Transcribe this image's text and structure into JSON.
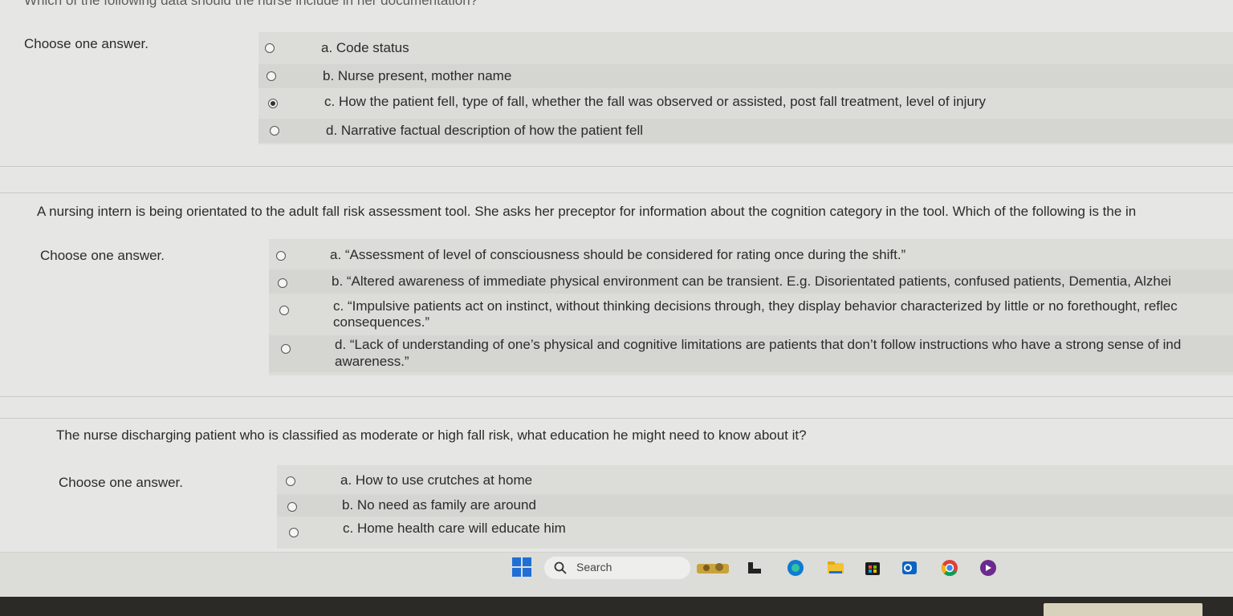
{
  "cut_off_header": "Which of the following data should the nurse include in her documentation?",
  "questions": [
    {
      "text": "",
      "choose_label": "Choose one answer.",
      "options": [
        {
          "label": "a. Code status",
          "checked": false
        },
        {
          "label": "b. Nurse present, mother name",
          "checked": false
        },
        {
          "label": "c. How the patient fell, type of fall, whether the fall was observed or assisted, post fall treatment, level of injury",
          "checked": true
        },
        {
          "label": "d. Narrative factual description of how the patient fell",
          "checked": false
        }
      ]
    },
    {
      "text": "A nursing intern is being orientated to the adult fall risk assessment tool. She asks her preceptor for information about the cognition category in the tool. Which of the following is the in",
      "choose_label": "Choose one answer.",
      "options": [
        {
          "label": "a. “Assessment of level of consciousness should be considered for rating once during the shift.”",
          "label2": "",
          "checked": false
        },
        {
          "label": "b. “Altered awareness of immediate physical environment can be transient. E.g. Disorientated patients, confused patients, Dementia, Alzhei",
          "label2": "",
          "checked": false
        },
        {
          "label": "c. “Impulsive patients act on instinct, without thinking decisions through, they display behavior characterized by little or no forethought, reflec",
          "label2": "consequences.”",
          "checked": false
        },
        {
          "label": "d. “Lack of understanding of one’s physical and cognitive limitations are patients that don’t follow instructions who have a strong sense of ind",
          "label2": "awareness.”",
          "checked": false
        }
      ]
    },
    {
      "text": "The nurse discharging patient who is classified as moderate or high fall risk, what education he might need to know about it?",
      "choose_label": "Choose one answer.",
      "options": [
        {
          "label": "a. How to use crutches at home",
          "checked": false
        },
        {
          "label": "b. No need as family are around",
          "checked": false
        },
        {
          "label": "c. Home health care will educate him",
          "checked": false
        }
      ]
    }
  ],
  "taskbar": {
    "search_placeholder": "Search",
    "icons": [
      "start-icon",
      "search-icon",
      "widgets-icon",
      "task-view-icon",
      "edge-icon",
      "file-explorer-icon",
      "store-icon",
      "outlook-icon",
      "chrome-icon",
      "media-player-icon"
    ]
  },
  "colors": {
    "accent": "#1f6fd6",
    "page_bg": "#e6e6e4",
    "option_bg": "#dcdcd9"
  }
}
